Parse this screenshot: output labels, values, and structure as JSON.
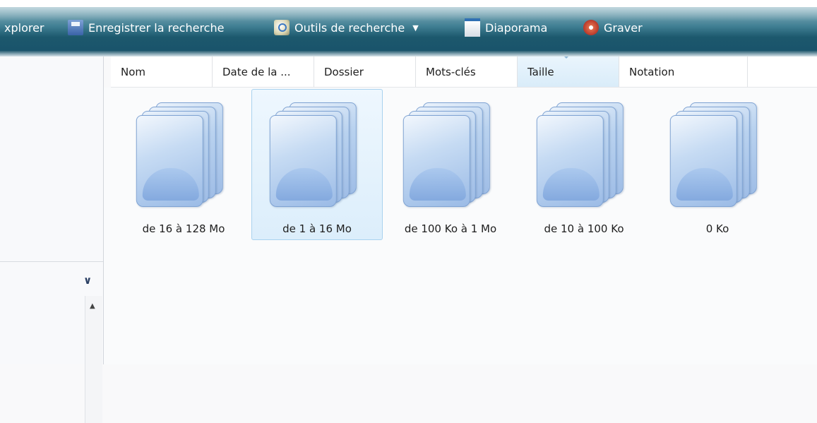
{
  "toolbar": {
    "items": [
      {
        "label": "xplorer"
      },
      {
        "label": "Enregistrer la recherche",
        "icon": "save-search-icon"
      },
      {
        "label": "Outils de recherche",
        "icon": "search-tools-icon"
      },
      {
        "label": "Diaporama",
        "icon": "slideshow-icon"
      },
      {
        "label": "Graver",
        "icon": "burn-disc-icon"
      }
    ]
  },
  "columns": [
    {
      "label": "Nom"
    },
    {
      "label": "Date de la ..."
    },
    {
      "label": "Dossier"
    },
    {
      "label": "Mots-clés"
    },
    {
      "label": "Taille",
      "sorted": true
    },
    {
      "label": "Notation"
    }
  ],
  "items": [
    {
      "label": "de 16 à 128 Mo",
      "selected": false
    },
    {
      "label": "de 1 à 16 Mo",
      "selected": true
    },
    {
      "label": "de 100 Ko à 1 Mo",
      "selected": false
    },
    {
      "label": "de 10 à 100 Ko",
      "selected": false
    },
    {
      "label": "0 Ko",
      "selected": false
    }
  ],
  "colors": {
    "toolbar": "#1c586d",
    "selection": "#dceefb",
    "selection_border": "#a9d2ef"
  }
}
